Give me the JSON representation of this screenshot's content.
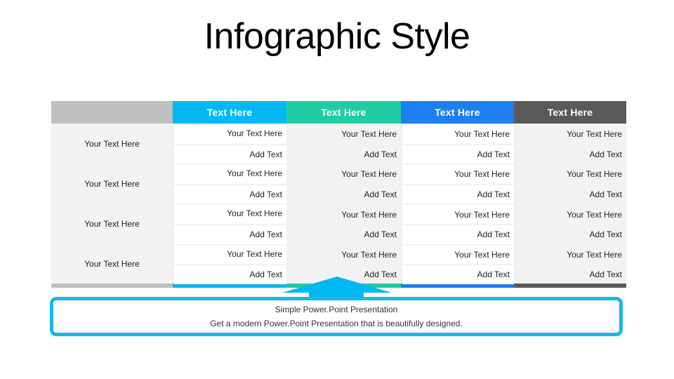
{
  "title": "Infographic Style",
  "colors": {
    "cyan": "#00b9f2",
    "green": "#21cca5",
    "blue": "#1e7ff0",
    "dark": "#595959",
    "gray_header": "#bfbfbf",
    "panel": "#f2f2f2",
    "callout_border": "#1ab8ec"
  },
  "table": {
    "columns": [
      {
        "header": "Text Here",
        "color": "cyan"
      },
      {
        "header": "Text Here",
        "color": "green"
      },
      {
        "header": "Text Here",
        "color": "blue"
      },
      {
        "header": "Text Here",
        "color": "dark"
      }
    ],
    "row_labels": [
      "Your Text  Here",
      "Your Text  Here",
      "Your Text  Here",
      "Your Text  Here"
    ],
    "rows": [
      {
        "line1": [
          "Your Text  Here",
          "Your Text  Here",
          "Your Text  Here",
          "Your Text  Here"
        ],
        "line2": [
          "Add Text",
          "Add Text",
          "Add Text",
          "Add Text"
        ]
      },
      {
        "line1": [
          "Your Text  Here",
          "Your Text  Here",
          "Your Text  Here",
          "Your Text  Here"
        ],
        "line2": [
          "Add Text",
          "Add Text",
          "Add Text",
          "Add Text"
        ]
      },
      {
        "line1": [
          "Your Text  Here",
          "Your Text  Here",
          "Your Text  Here",
          "Your Text  Here"
        ],
        "line2": [
          "Add Text",
          "Add Text",
          "Add Text",
          "Add Text"
        ]
      },
      {
        "line1": [
          "Your Text  Here",
          "Your Text  Here",
          "Your Text  Here",
          "Your Text  Here"
        ],
        "line2": [
          "Add Text",
          "Add Text",
          "Add Text",
          "Add Text"
        ]
      }
    ]
  },
  "callout": {
    "line1": "Simple Power.Point Presentation",
    "line2": "Get a modern Power.Point  Presentation that is beautifully designed."
  }
}
